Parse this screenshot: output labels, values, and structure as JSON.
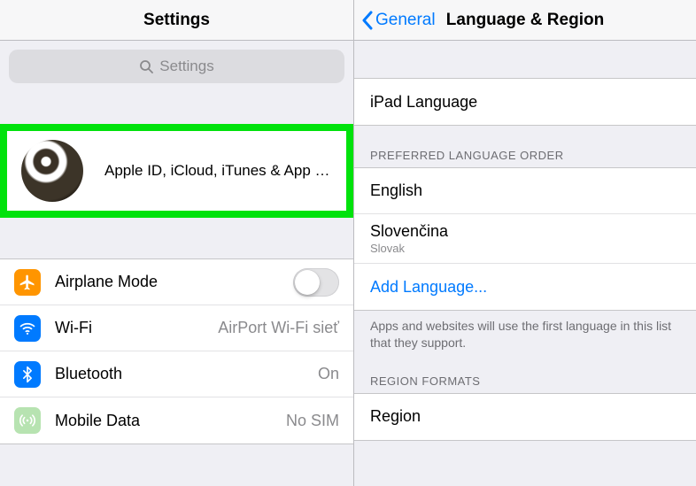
{
  "left": {
    "title": "Settings",
    "search": {
      "placeholder": "Settings",
      "iconName": "search-icon"
    },
    "account": {
      "subtitle": "Apple ID, iCloud, iTunes & App St..."
    },
    "items": [
      {
        "name": "airplane-mode-cell",
        "iconClass": "ic-airplane",
        "iconName": "airplane-icon",
        "label": "Airplane Mode",
        "type": "switch",
        "value": ""
      },
      {
        "name": "wifi-cell",
        "iconClass": "ic-wifi",
        "iconName": "wifi-icon",
        "label": "Wi-Fi",
        "type": "value",
        "value": "AirPort Wi-Fi sieť"
      },
      {
        "name": "bluetooth-cell",
        "iconClass": "ic-bt",
        "iconName": "bluetooth-icon",
        "label": "Bluetooth",
        "type": "value",
        "value": "On"
      },
      {
        "name": "mobile-data-cell",
        "iconClass": "ic-cell",
        "iconName": "cellular-icon",
        "label": "Mobile Data",
        "type": "value",
        "value": "No SIM"
      }
    ]
  },
  "right": {
    "backLabel": "General",
    "title": "Language & Region",
    "ipadLanguage": {
      "label": "iPad Language"
    },
    "prefHeader": "PREFERRED LANGUAGE ORDER",
    "langs": [
      {
        "title": "English",
        "sub": ""
      },
      {
        "title": "Slovenčina",
        "sub": "Slovak"
      }
    ],
    "addLanguage": "Add Language...",
    "langFooter": "Apps and websites will use the first language in this list that they support.",
    "regionHeader": "REGION FORMATS",
    "regionCell": {
      "label": "Region"
    }
  }
}
